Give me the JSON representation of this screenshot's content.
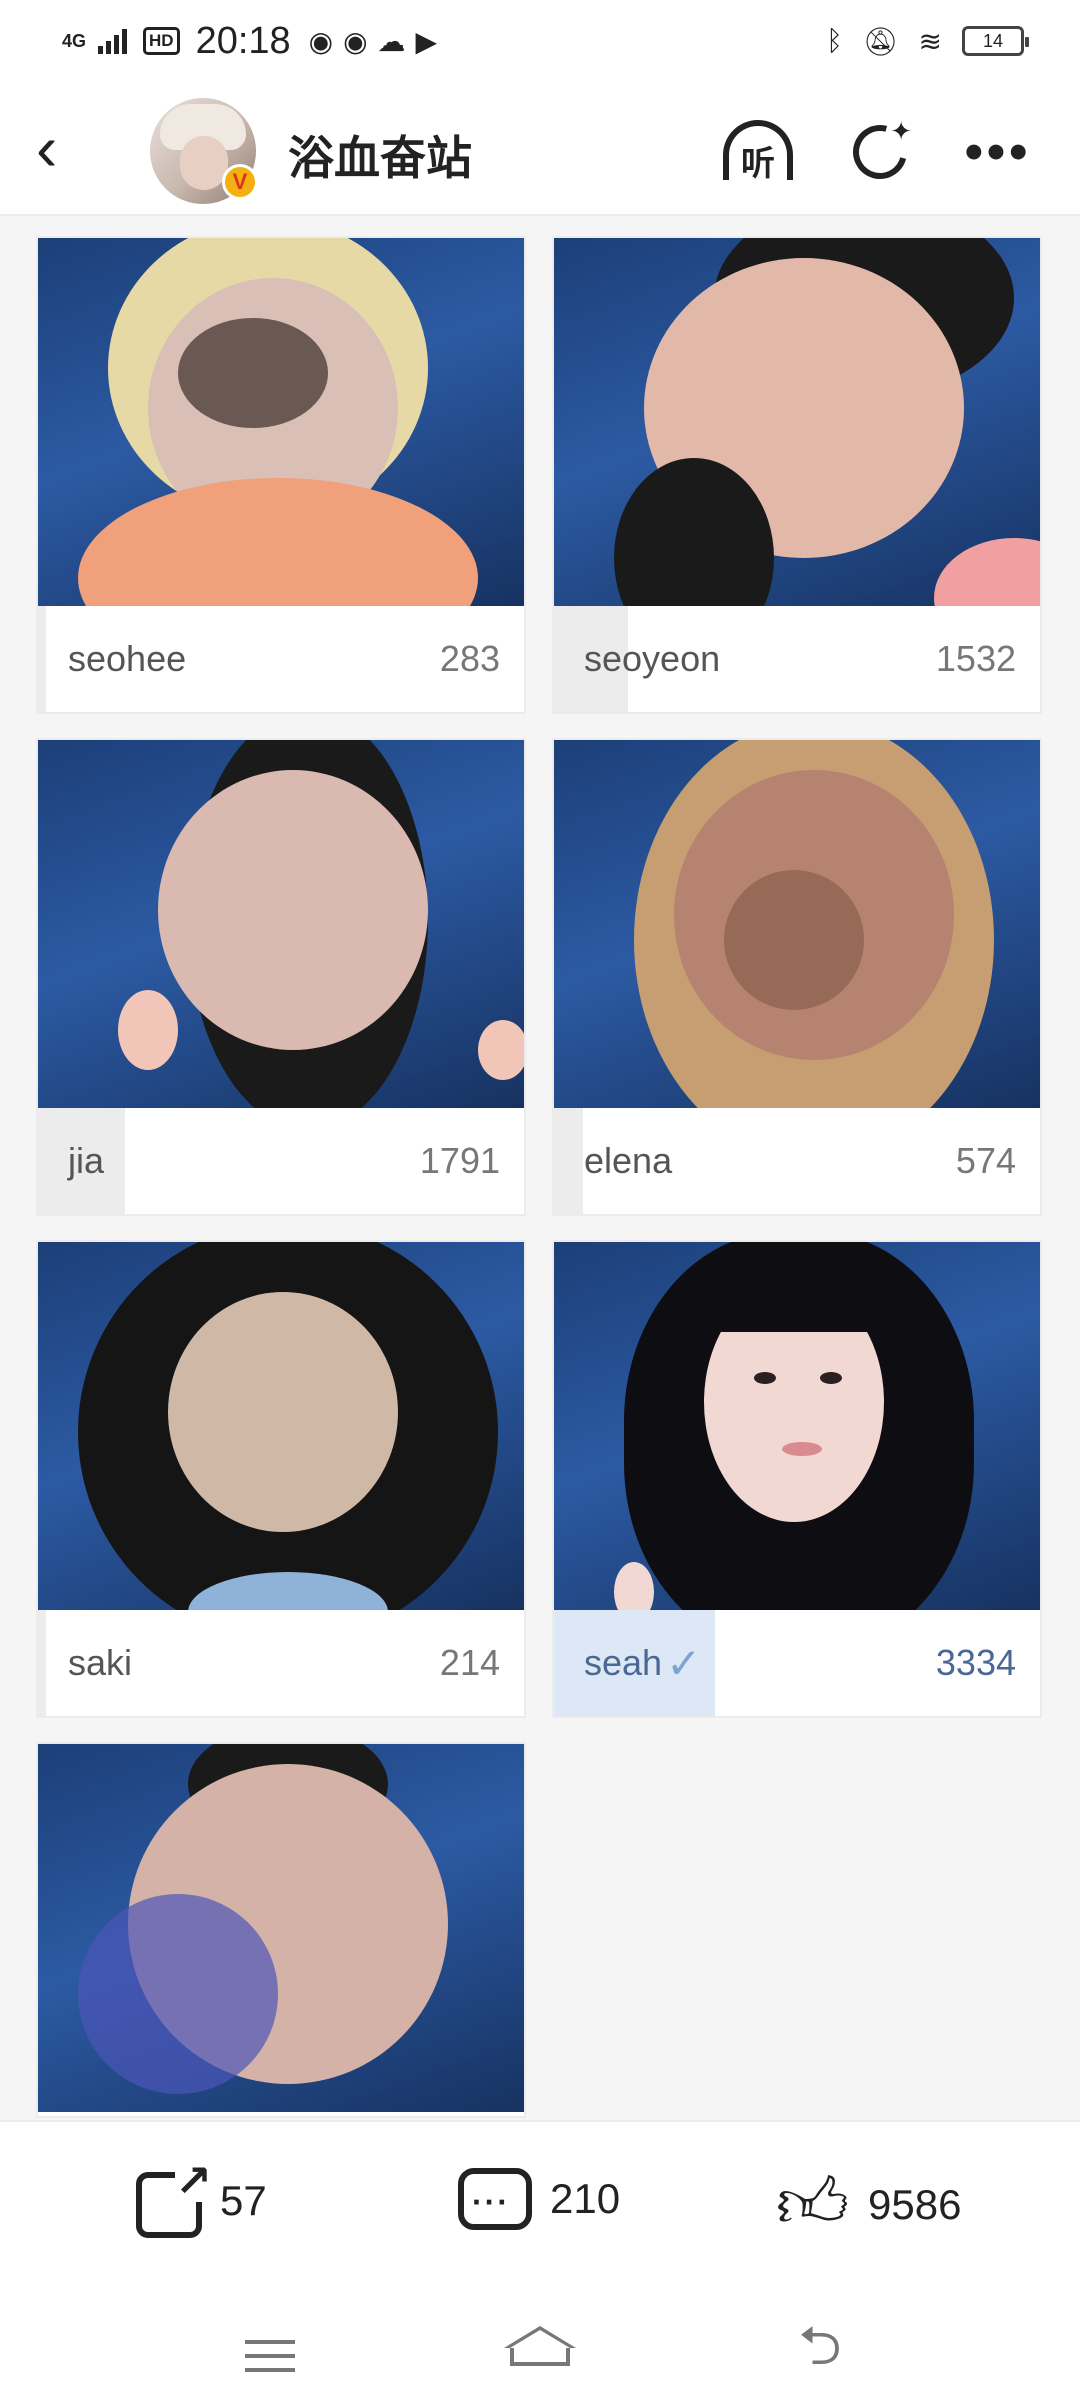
{
  "status_bar": {
    "network": "4G",
    "hd": "HD",
    "time": "20:18",
    "app_icons": [
      "weibo-icon",
      "weibo-icon",
      "wechat-icon",
      "video-icon"
    ],
    "right_icons": [
      "bluetooth-icon",
      "mute-icon",
      "wifi-icon"
    ],
    "battery": "14"
  },
  "header": {
    "title": "浴血奋站",
    "verified_badge": "V",
    "listen_label": "听",
    "back_glyph": "‹",
    "more_glyph": "•••"
  },
  "cards": [
    {
      "name": "seohee",
      "count": "283",
      "vote_share": 0.02,
      "selected": false
    },
    {
      "name": "seoyeon",
      "count": "1532",
      "vote_share": 0.18,
      "selected": false
    },
    {
      "name": "jia",
      "count": "1791",
      "vote_share": 0.21,
      "selected": false
    },
    {
      "name": "elena",
      "count": "574",
      "vote_share": 0.07,
      "selected": false
    },
    {
      "name": "saki",
      "count": "214",
      "vote_share": 0.02,
      "selected": false
    },
    {
      "name": "seah",
      "count": "3334",
      "vote_share": 0.39,
      "selected": true
    },
    {
      "name": "",
      "count": "",
      "vote_share": 0,
      "selected": false
    }
  ],
  "selected_check": "✓",
  "actions": {
    "share_count": "57",
    "comment_count": "210",
    "like_count": "9586"
  },
  "colors": {
    "accent_selected": "#4a6894",
    "bar_fill": "#ececec",
    "bar_fill_selected": "#dde8f6"
  }
}
